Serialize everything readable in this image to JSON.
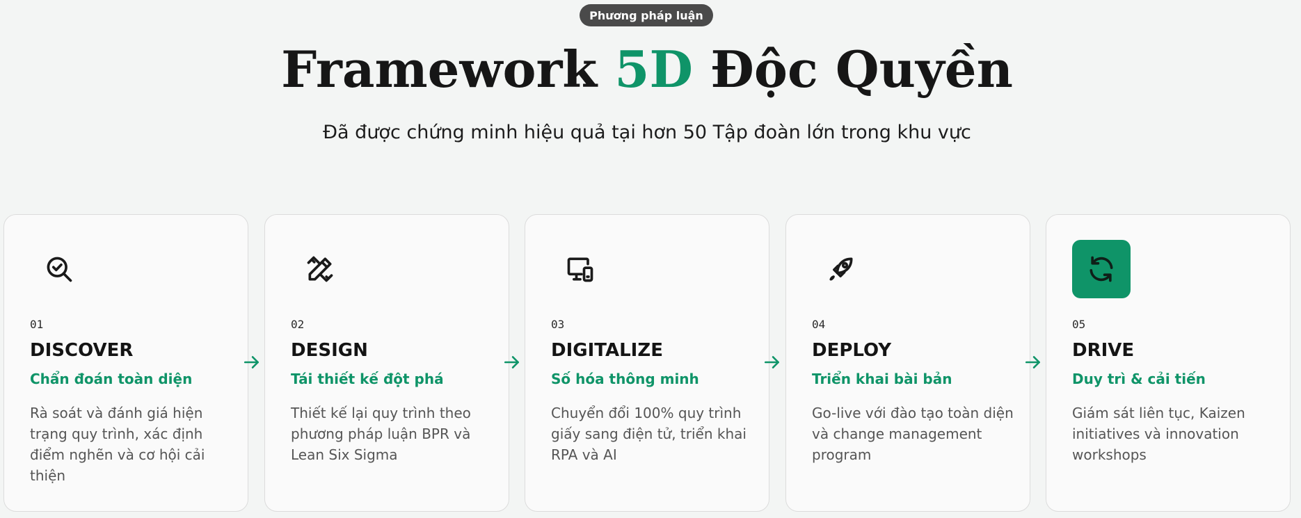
{
  "header": {
    "badge": "Phương pháp luận",
    "title_part1": "Framework ",
    "title_accent": "5D",
    "title_part2": " Độc Quyền",
    "subtitle": "Đã được chứng minh hiệu quả tại hơn 50 Tập đoàn lớn trong khu vực"
  },
  "colors": {
    "accent": "#0f9468",
    "badge_bg": "#4a4a4a",
    "card_bg": "#fafafa",
    "page_bg": "#f3f5f4"
  },
  "steps": [
    {
      "number": "01",
      "name": "DISCOVER",
      "tagline": "Chẩn đoán toàn diện",
      "description": "Rà soát và đánh giá hiện trạng quy trình, xác định điểm nghẽn và cơ hội cải thiện",
      "icon": "search-check-icon",
      "active": false
    },
    {
      "number": "02",
      "name": "DESIGN",
      "tagline": "Tái thiết kế đột phá",
      "description": "Thiết kế lại quy trình theo phương pháp luận BPR và Lean Six Sigma",
      "icon": "pencil-ruler-icon",
      "active": false
    },
    {
      "number": "03",
      "name": "DIGITALIZE",
      "tagline": "Số hóa thông minh",
      "description": "Chuyển đổi 100% quy trình giấy sang điện tử, triển khai RPA và AI",
      "icon": "devices-icon",
      "active": false
    },
    {
      "number": "04",
      "name": "DEPLOY",
      "tagline": "Triển khai bài bản",
      "description": "Go-live với đào tạo toàn diện và change management program",
      "icon": "rocket-icon",
      "active": false
    },
    {
      "number": "05",
      "name": "DRIVE",
      "tagline": "Duy trì & cải tiến",
      "description": "Giám sát liên tục, Kaizen initiatives và innovation workshops",
      "icon": "refresh-icon",
      "active": true
    }
  ]
}
